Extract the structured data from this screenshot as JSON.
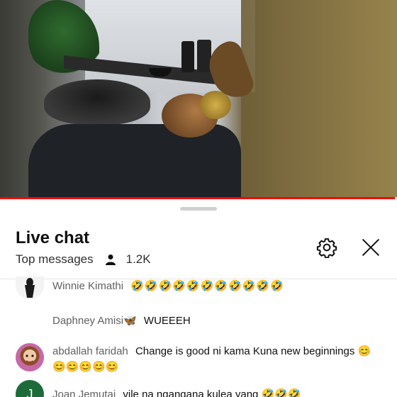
{
  "video": {
    "progress_fraction": 0.995
  },
  "live_chat": {
    "title": "Live chat",
    "mode": "Top messages",
    "viewer_count": "1.2K"
  },
  "messages": [
    {
      "author": "Winnie Kimathi",
      "text": "🤣🤣🤣🤣🤣🤣🤣🤣🤣🤣🤣",
      "avatar": "dark-figure"
    },
    {
      "author": "Daphney Amisi🦋",
      "text": "WUEEEH",
      "avatar": ""
    },
    {
      "author": "abdallah faridah",
      "text": "Change is good ni kama Kuna new beginnings 😊😊😊😊😊😊",
      "avatar": "pink-face"
    },
    {
      "author": "Joan Jemutai",
      "text": "vile na ngangana kulea yang 🤣🤣🤣",
      "avatar": "green-letter",
      "avatar_letter": "J"
    }
  ],
  "colors": {
    "accent": "#ff0000",
    "avatar_green": "#1e6b3a",
    "avatar_pink": "#c768a5"
  }
}
